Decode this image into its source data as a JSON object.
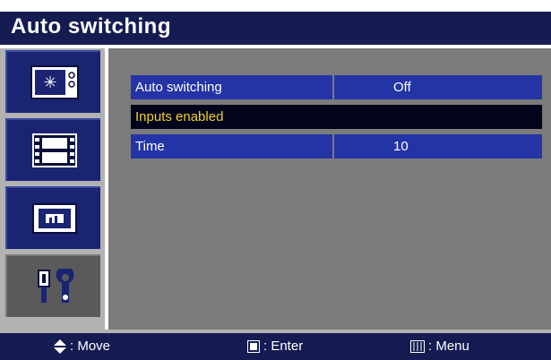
{
  "title": "Auto switching",
  "sidebar": {
    "items": [
      {
        "icon": "picture-settings-icon",
        "selected": false
      },
      {
        "icon": "film-strip-icon",
        "selected": false
      },
      {
        "icon": "screen-display-icon",
        "selected": false
      },
      {
        "icon": "tools-icon",
        "selected": true
      }
    ]
  },
  "menu": {
    "rows": [
      {
        "label": "Auto switching",
        "value": "Off"
      },
      {
        "label": "Inputs enabled",
        "highlighted": true
      },
      {
        "label": "Time",
        "value": "10"
      }
    ]
  },
  "footer": {
    "move_label": ": Move",
    "enter_label": ": Enter",
    "menu_label": ": Menu"
  },
  "colors": {
    "title_bar": "#151c52",
    "row_bg": "#2434a6",
    "highlight_bg": "#02041c",
    "highlight_text": "#f3d21a",
    "panel_bg": "#7b7b7b",
    "sidebar_bg": "#b2b2b2"
  }
}
